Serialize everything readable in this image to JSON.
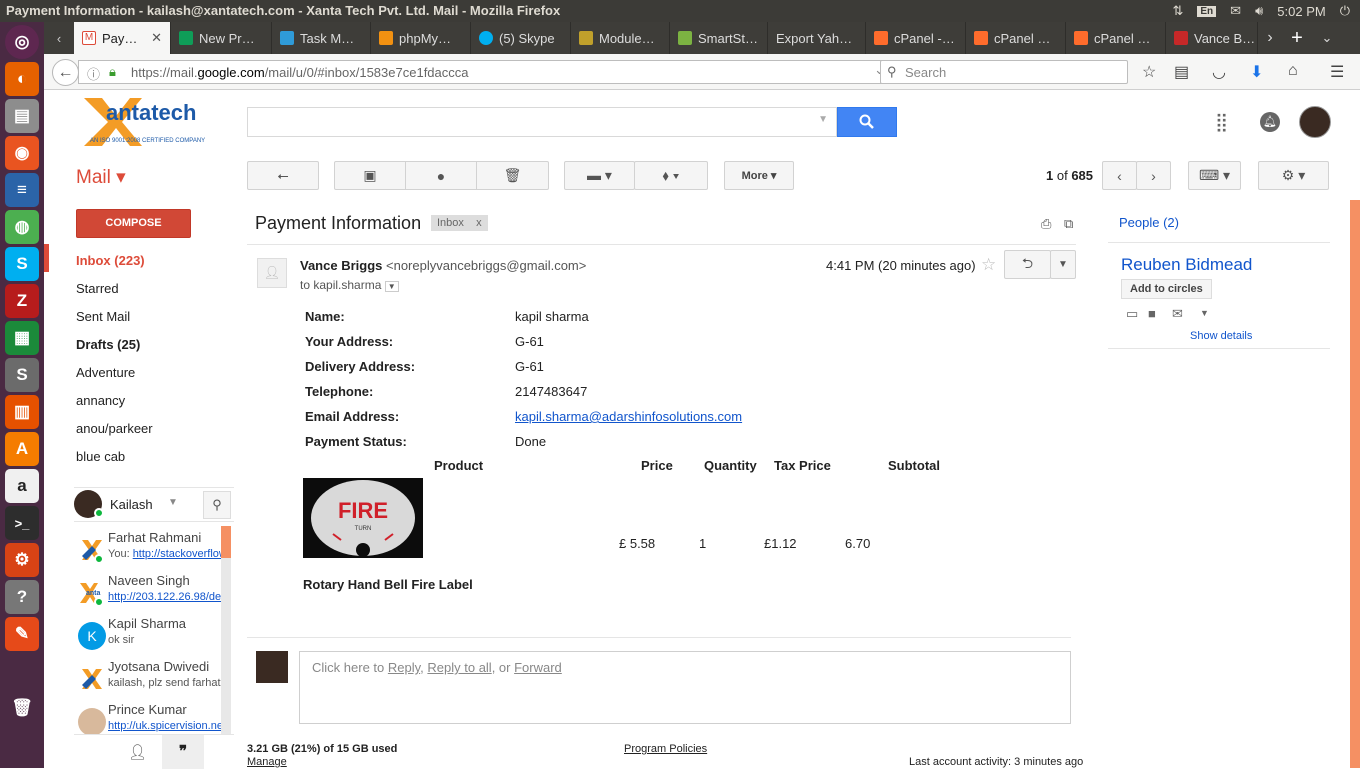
{
  "os": {
    "window_title": "Payment Information - kailash@xantatech.com - Xanta Tech Pvt. Ltd. Mail - Mozilla Firefox",
    "keyboard": "En",
    "clock": "5:02 PM"
  },
  "browser": {
    "tabs": [
      {
        "label": "Pay…",
        "color": "#dd4b39"
      },
      {
        "label": "New Pr…",
        "color": "#0f9d58"
      },
      {
        "label": "Task M…",
        "color": "#2f9bd8"
      },
      {
        "label": "phpMy…",
        "color": "#f29111"
      },
      {
        "label": "(5) Skype",
        "color": "#00aff0"
      },
      {
        "label": "Module…",
        "color": "#c0a02b"
      },
      {
        "label": "SmartSt…",
        "color": "#7cb342"
      },
      {
        "label": "Export Yah…",
        "color": ""
      },
      {
        "label": "cPanel -…",
        "color": "#ff6c2c"
      },
      {
        "label": "cPanel …",
        "color": "#ff6c2c"
      },
      {
        "label": "cPanel …",
        "color": "#ff6c2c"
      },
      {
        "label": "Vance B…",
        "color": "#c62828"
      }
    ],
    "url_prefix": "https://mail.",
    "url_domain": "google.com",
    "url_rest": "/mail/u/0/#inbox/1583e7ce1fdaccca",
    "search_placeholder": "Search"
  },
  "gmail": {
    "mail_label": "Mail ▾",
    "compose": "COMPOSE",
    "more": "More",
    "pager": {
      "current": "1",
      "of": "of",
      "total": "685"
    },
    "nav": [
      {
        "label": "Inbox (223)",
        "style": "sel"
      },
      {
        "label": "Starred",
        "style": ""
      },
      {
        "label": "Sent Mail",
        "style": ""
      },
      {
        "label": "Drafts (25)",
        "style": "bold"
      },
      {
        "label": "Adventure",
        "style": ""
      },
      {
        "label": "annancy",
        "style": ""
      },
      {
        "label": "anou/parkeer",
        "style": ""
      },
      {
        "label": "blue cab",
        "style": ""
      }
    ],
    "chat_user": "Kailash",
    "chats": [
      {
        "name": "Farhat Rahmani",
        "msg_prefix": "You: ",
        "msg_link": "http://stackoverflow",
        "msg": "",
        "online": true
      },
      {
        "name": "Naveen Singh",
        "msg_prefix": "",
        "msg_link": "http://203.122.26.98/dev",
        "msg": "",
        "online": true
      },
      {
        "name": "Kapil Sharma",
        "msg_prefix": "",
        "msg_link": "",
        "msg": "ok sir",
        "online": false
      },
      {
        "name": "Jyotsana Dwivedi",
        "msg_prefix": "",
        "msg_link": "",
        "msg": "kailash, plz send farhat",
        "online": false
      },
      {
        "name": "Prince Kumar",
        "msg_prefix": "",
        "msg_link": "http://uk.spicervision.net",
        "msg": "",
        "online": false
      }
    ]
  },
  "email": {
    "subject": "Payment Information",
    "label": "Inbox",
    "label_close": "x",
    "sender_name": "Vance Briggs",
    "sender_email": "<noreplyvancebriggs@gmail.com>",
    "to": "to kapil.sharma",
    "time": "4:41 PM (20 minutes ago)",
    "fields": [
      {
        "label": "Name:",
        "value": "kapil sharma",
        "link": false
      },
      {
        "label": "Your Address:",
        "value": "G-61",
        "link": false
      },
      {
        "label": "Delivery Address:",
        "value": "G-61",
        "link": false
      },
      {
        "label": "Telephone:",
        "value": "2147483647",
        "link": false
      },
      {
        "label": "Email Address:",
        "value": "kapil.sharma@adarshinfosolutions.com",
        "link": true
      },
      {
        "label": "Payment Status:",
        "value": "Done",
        "link": false
      }
    ],
    "table_headers": {
      "product": "Product",
      "price": "Price",
      "quantity": "Quantity",
      "tax": "Tax Price",
      "subtotal": "Subtotal"
    },
    "item": {
      "price": "£ 5.58",
      "quantity": "1",
      "tax": "£1.12",
      "subtotal": "6.70",
      "name": "Rotary Hand Bell Fire Label",
      "image_text": "FIRE",
      "image_subtext": "TURN"
    },
    "reply_prefix": "Click here to ",
    "reply": "Reply",
    "sep1": ", ",
    "reply_all": "Reply to all",
    "sep2": ", or ",
    "forward": "Forward"
  },
  "footer": {
    "storage": "3.21 GB (21%) of 15 GB used",
    "manage": "Manage",
    "policies": "Program Policies",
    "activity": "Last account activity: 3 minutes ago"
  },
  "people": {
    "header": "People (2)",
    "name": "Reuben Bidmead",
    "add": "Add to circles",
    "details": "Show details"
  }
}
